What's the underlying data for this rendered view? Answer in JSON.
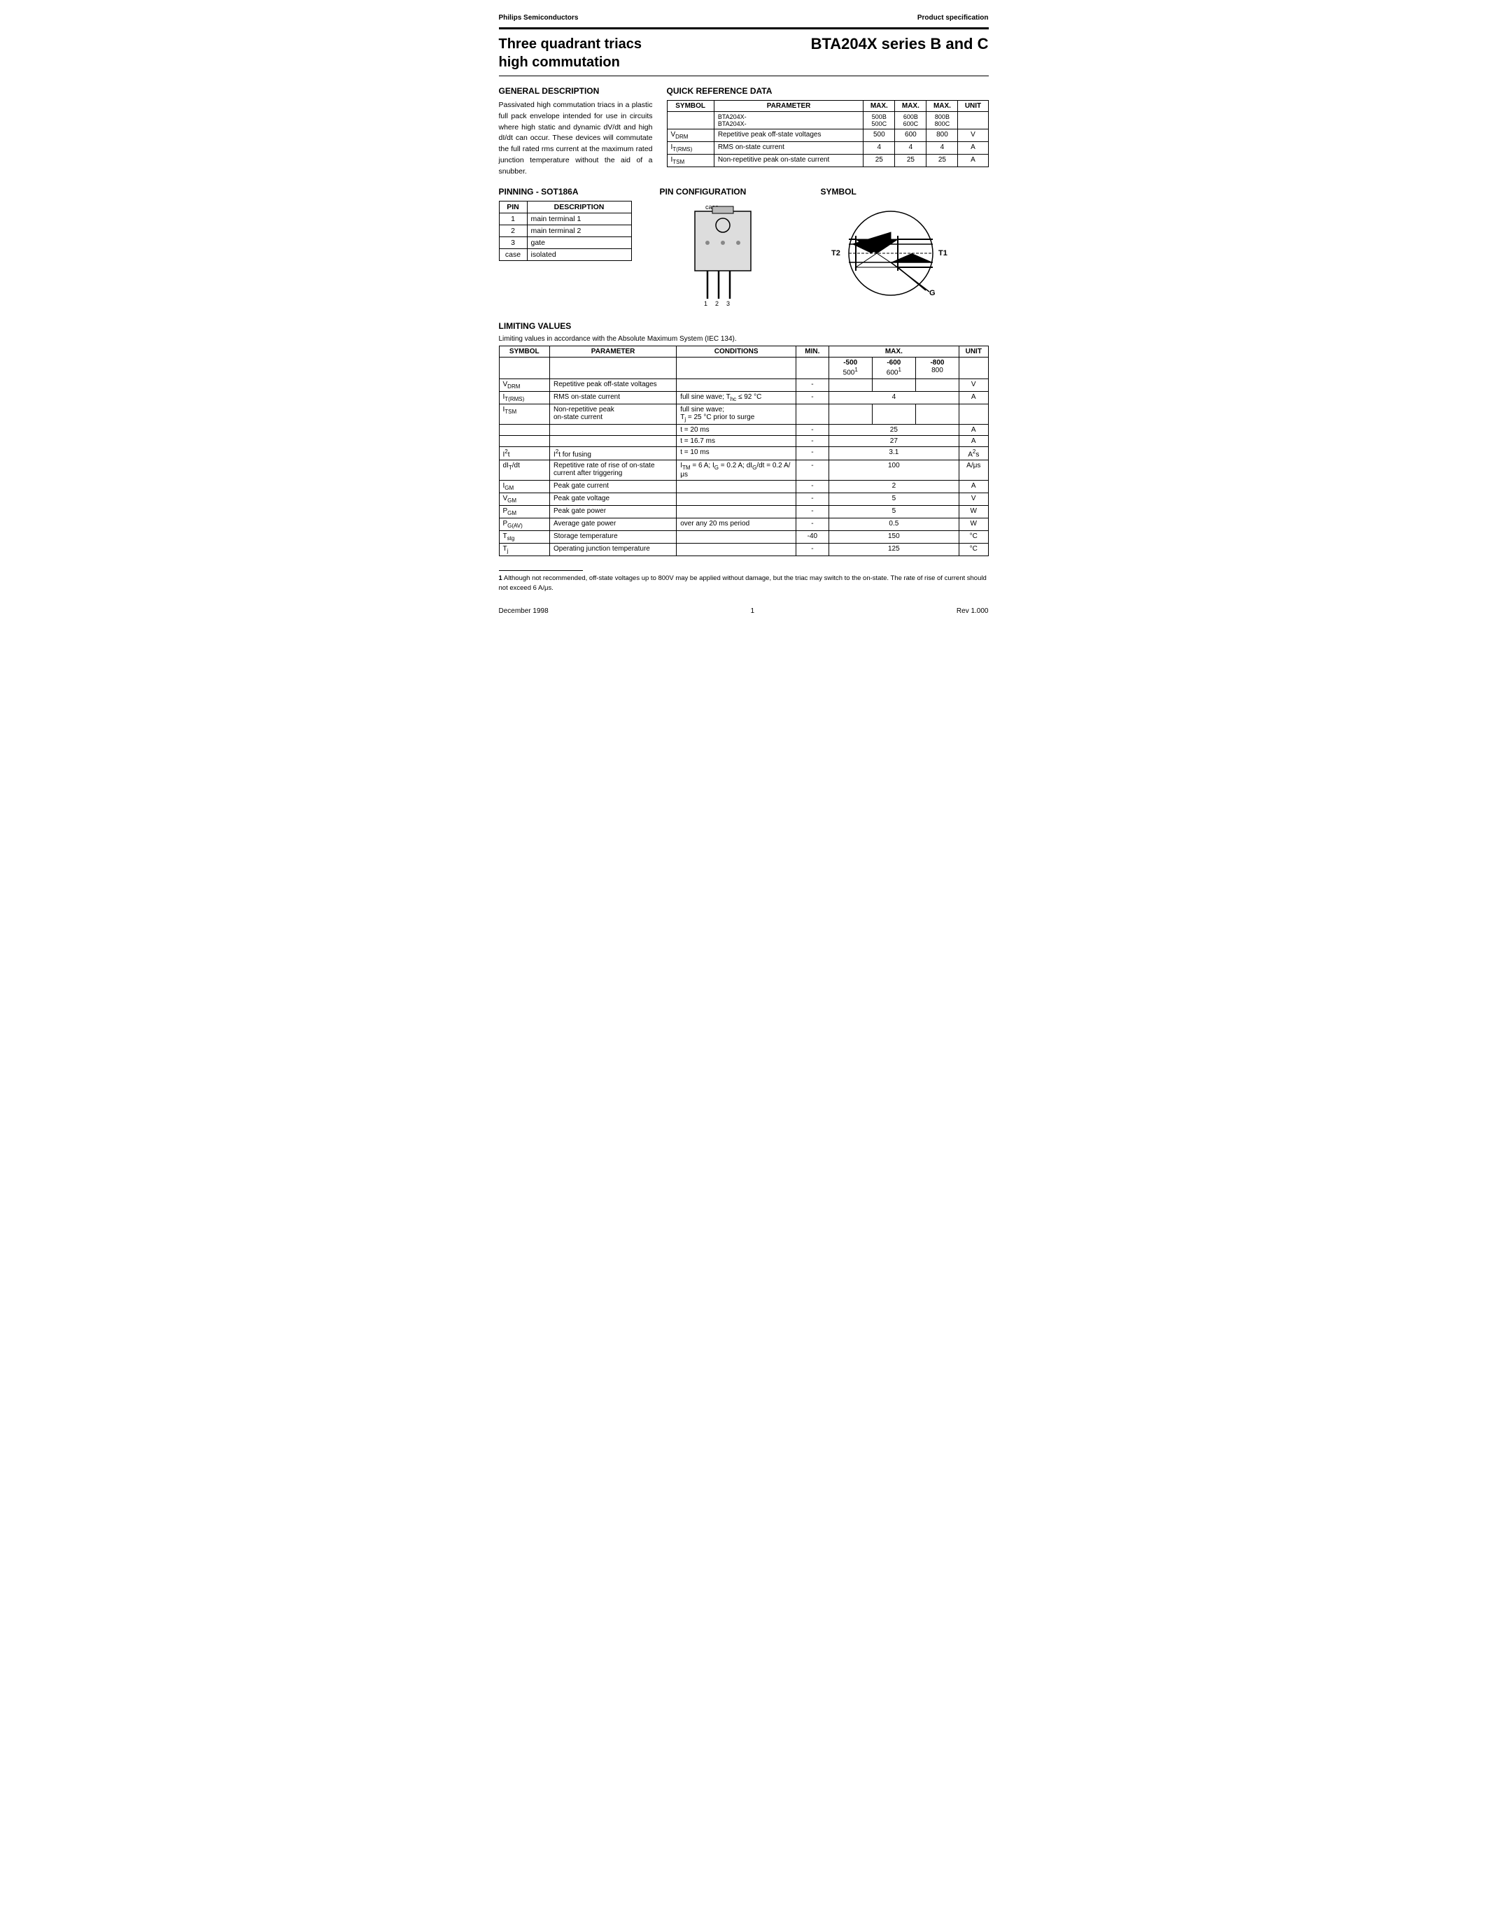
{
  "header": {
    "company": "Philips Semiconductors",
    "doc_type": "Product specification"
  },
  "title": {
    "left_line1": "Three quadrant triacs",
    "left_line2": "high commutation",
    "right": "BTA204X series  B and C"
  },
  "general_description": {
    "heading": "GENERAL DESCRIPTION",
    "text": "Passivated high commutation triacs in a plastic full pack envelope intended for use in circuits where high static and dynamic dV/dt and high dI/dt can occur. These devices will commutate the full rated rms current at the maximum rated junction temperature without the aid of a snubber."
  },
  "quick_reference": {
    "heading": "QUICK REFERENCE DATA",
    "columns": [
      "SYMBOL",
      "PARAMETER",
      "MAX.",
      "MAX.",
      "MAX.",
      "UNIT"
    ],
    "sub_header": [
      "",
      "BTA204X-\nBTA204X-",
      "500B\n500C",
      "600B\n600C",
      "800B\n800C",
      ""
    ],
    "rows": [
      {
        "symbol": "V_DRM",
        "parameter": "Repetitive peak off-state voltages",
        "v500": "500",
        "v600": "600",
        "v800": "800",
        "unit": "V"
      },
      {
        "symbol": "I_T(RMS)",
        "parameter": "RMS on-state current",
        "v500": "4",
        "v600": "4",
        "v800": "4",
        "unit": "A"
      },
      {
        "symbol": "I_TSM",
        "parameter": "Non-repetitive peak on-state current",
        "v500": "25",
        "v600": "25",
        "v800": "25",
        "unit": "A"
      }
    ]
  },
  "pinning": {
    "heading": "PINNING - SOT186A",
    "pin_config_heading": "PIN CONFIGURATION",
    "symbol_heading": "SYMBOL",
    "pins": [
      {
        "pin": "1",
        "description": "main terminal 1"
      },
      {
        "pin": "2",
        "description": "main terminal 2"
      },
      {
        "pin": "3",
        "description": "gate"
      },
      {
        "pin": "case",
        "description": "isolated"
      }
    ]
  },
  "limiting_values": {
    "heading": "LIMITING VALUES",
    "desc": "Limiting values in accordance with the Absolute Maximum System (IEC 134).",
    "columns": [
      "SYMBOL",
      "PARAMETER",
      "CONDITIONS",
      "MIN.",
      "MAX.",
      "UNIT"
    ],
    "rows": [
      {
        "symbol": "V_DRM",
        "parameter": "Repetitive peak off-state voltages",
        "conditions": "",
        "min": "-",
        "max_500": "-500\n500¹",
        "max_600": "-600\n600¹",
        "max_800": "-800\n800",
        "unit": "V"
      },
      {
        "symbol": "I_T(RMS)",
        "parameter": "RMS on-state current",
        "conditions": "full sine wave; T_hc ≤ 92 °C",
        "min": "-",
        "max": "4",
        "unit": "A"
      },
      {
        "symbol": "I_TSM",
        "parameter": "Non-repetitive peak on-state current",
        "conditions": "full sine wave; T_j = 25 °C prior to surge",
        "min": "",
        "max": "",
        "unit": ""
      },
      {
        "symbol": "",
        "parameter": "",
        "conditions": "t = 20 ms",
        "min": "-",
        "max": "25",
        "unit": "A"
      },
      {
        "symbol": "",
        "parameter": "",
        "conditions": "t = 16.7 ms",
        "min": "-",
        "max": "27",
        "unit": "A"
      },
      {
        "symbol": "I²t",
        "parameter": "I²t for fusing",
        "conditions": "t = 10 ms",
        "min": "-",
        "max": "3.1",
        "unit": "A²s"
      },
      {
        "symbol": "dI_T/dt",
        "parameter": "Repetitive rate of rise of on-state current after triggering",
        "conditions": "I_TM = 6 A; I_G = 0.2 A; dI_G/dt = 0.2 A/μs",
        "min": "-",
        "max": "100",
        "unit": "A/μs"
      },
      {
        "symbol": "I_GM",
        "parameter": "Peak gate current",
        "conditions": "",
        "min": "-",
        "max": "2",
        "unit": "A"
      },
      {
        "symbol": "V_GM",
        "parameter": "Peak gate voltage",
        "conditions": "",
        "min": "-",
        "max": "5",
        "unit": "V"
      },
      {
        "symbol": "P_GM",
        "parameter": "Peak gate power",
        "conditions": "",
        "min": "-",
        "max": "5",
        "unit": "W"
      },
      {
        "symbol": "P_G(AV)",
        "parameter": "Average gate power",
        "conditions": "over any 20 ms period",
        "min": "-",
        "max": "0.5",
        "unit": "W"
      },
      {
        "symbol": "T_stg",
        "parameter": "Storage temperature",
        "conditions": "",
        "min": "-40",
        "max": "150",
        "unit": "°C"
      },
      {
        "symbol": "T_j",
        "parameter": "Operating junction temperature",
        "conditions": "",
        "min": "-",
        "max": "125",
        "unit": "°C"
      }
    ]
  },
  "footnote": {
    "number": "1",
    "text": "Although not recommended, off-state voltages up to 800V may be applied without damage, but the triac may switch to the on-state. The rate of rise of current should not exceed 6 A/μs."
  },
  "footer": {
    "date": "December 1998",
    "page": "1",
    "revision": "Rev 1.000"
  }
}
